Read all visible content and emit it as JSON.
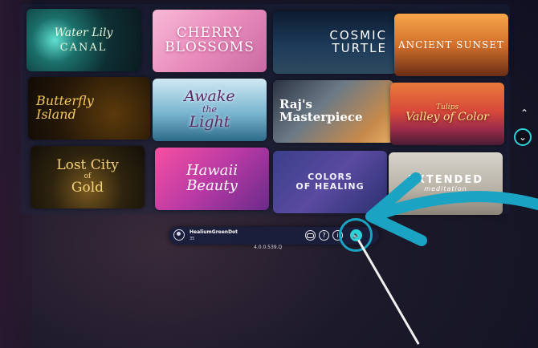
{
  "tiles": {
    "water_lily_canal": {
      "line1": "Water Lily",
      "line2": "CANAL"
    },
    "cherry_blossoms": {
      "line1": "CHERRY",
      "line2": "BLOSSOMS"
    },
    "cosmic_turtle": {
      "line1": "COSMIC",
      "line2": "TURTLE"
    },
    "ancient_sunset": {
      "line1": "ANCIENT SUNSET"
    },
    "butterfly_island": {
      "line1": "Butterfly",
      "line2": "Island"
    },
    "awake_the_light": {
      "line1": "Awake",
      "line2": "the",
      "line3": "Light"
    },
    "rajs_masterpiece": {
      "line1": "Raj's",
      "line2": "Masterpiece"
    },
    "tulips_valley_of_color": {
      "line1": "Tulips",
      "line2": "Valley of Color"
    },
    "lost_city_of_gold": {
      "line1": "Lost City",
      "line2": "of",
      "line3": "Gold"
    },
    "hawaii_beauty": {
      "line1": "Hawaii",
      "line2": "Beauty"
    },
    "colors_of_healing": {
      "line1": "COLORS",
      "line2": "OF HEALING"
    },
    "extended_meditation": {
      "line1": "EXTENDED",
      "line2": "meditation"
    }
  },
  "scroll": {
    "up_glyph": "⌃",
    "down_glyph": "⌄"
  },
  "toolbar": {
    "username": "HealiumGreenDot",
    "user_subtext": "35",
    "help_glyph": "?",
    "info_glyph": "i",
    "volume_glyph": "🔈"
  },
  "version": "4.0.0.539.Q",
  "colors": {
    "accent": "#2bd3d8",
    "arrow": "#1aa3c3",
    "toolbar_bg": "#1a1e3c"
  },
  "icons": [
    "user-icon",
    "vr-glasses-icon",
    "help-icon",
    "info-icon",
    "volume-icon",
    "chevron-up-icon",
    "chevron-down-icon"
  ]
}
